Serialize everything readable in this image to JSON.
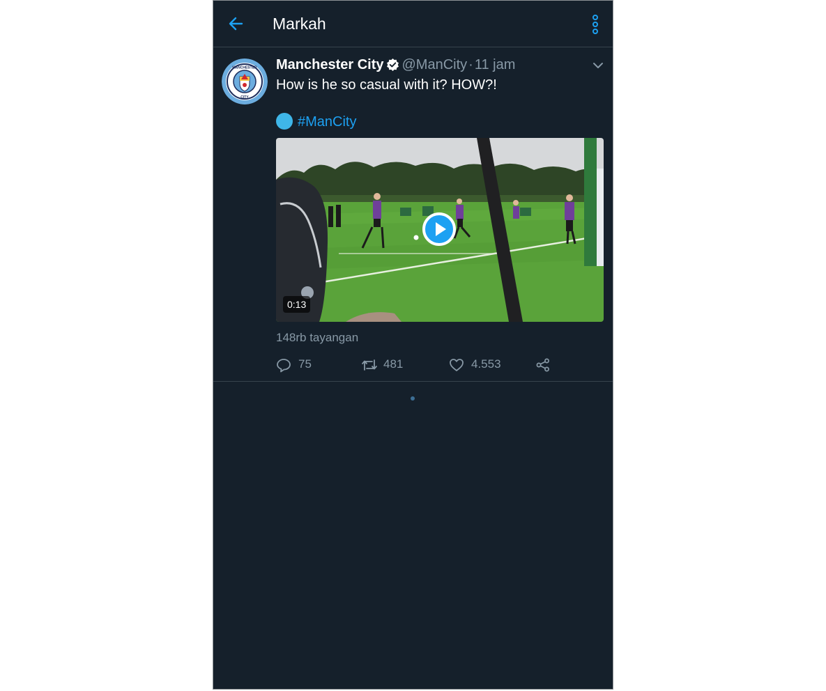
{
  "header": {
    "title": "Markah",
    "back_icon": "arrow-left-icon",
    "more_icon": "vertical-dots-icon"
  },
  "tweet": {
    "author_name": "Manchester City",
    "verified_icon": "verified-badge-icon",
    "handle": "@ManCity",
    "separator": "·",
    "time": "11 jam",
    "text": "How is he so casual with it? HOW?!",
    "hashtag_emoji": "blue-circle-emoji",
    "hashtag": "#ManCity",
    "avatar_crest_top": "MANCHESTER",
    "avatar_crest_bottom": "CITY",
    "media": {
      "type": "video",
      "duration": "0:13",
      "play_icon": "play-icon"
    },
    "views": "148rb tayangan",
    "actions": {
      "reply_count": "75",
      "retweet_count": "481",
      "like_count": "4.553",
      "share_icon": "share-icon"
    }
  },
  "colors": {
    "background": "#15202b",
    "accent": "#1da1f2",
    "text_primary": "#ffffff",
    "text_secondary": "#8899a6",
    "divider": "#38444d"
  }
}
